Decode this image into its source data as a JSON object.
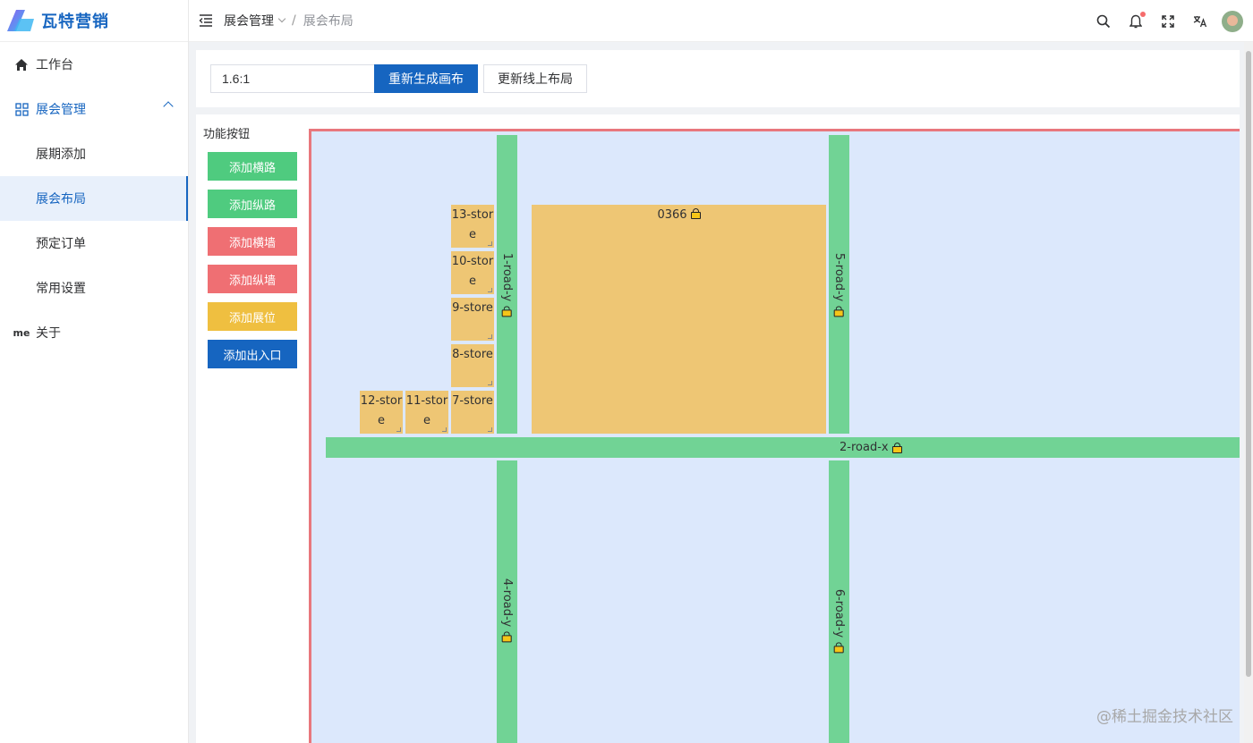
{
  "app": {
    "name": "瓦特营销"
  },
  "sidebar": {
    "items": [
      {
        "label": "工作台",
        "icon": "home-icon"
      },
      {
        "label": "展会管理",
        "icon": "grid-icon",
        "expanded": true
      },
      {
        "label": "展期添加"
      },
      {
        "label": "展会布局",
        "active": true
      },
      {
        "label": "预定订单"
      },
      {
        "label": "常用设置"
      },
      {
        "label": "关于",
        "icon_text": "me"
      }
    ]
  },
  "header": {
    "breadcrumb": [
      "展会管理",
      "展会布局"
    ],
    "icons": [
      "search-icon",
      "bell-icon",
      "fullscreen-icon",
      "translate-icon",
      "avatar"
    ]
  },
  "toolbar": {
    "ratio_value": "1.6:1",
    "regen_label": "重新生成画布",
    "update_label": "更新线上布局"
  },
  "functions": {
    "title": "功能按钮",
    "buttons": [
      {
        "label": "添加横路",
        "color": "#4fcb7f"
      },
      {
        "label": "添加纵路",
        "color": "#4fcb7f"
      },
      {
        "label": "添加横墙",
        "color": "#ef6f73"
      },
      {
        "label": "添加纵墙",
        "color": "#ef6f73"
      },
      {
        "label": "添加展位",
        "color": "#efbf40"
      },
      {
        "label": "添加出入口",
        "color": "#1665c0"
      }
    ]
  },
  "layout": {
    "roads": [
      "1-road-y",
      "5-road-y",
      "2-road-x",
      "4-road-y",
      "6-road-y"
    ],
    "stores": [
      "13-store",
      "10-store",
      "9-store",
      "8-store",
      "7-store",
      "11-store",
      "12-store"
    ],
    "booth": "0366"
  },
  "colors": {
    "primary": "#1665c0",
    "road": "#71d395",
    "store": "#eec674",
    "canvas": "#dce8fc",
    "canvas_border": "#e8777d"
  },
  "watermark": "@稀土掘金技术社区"
}
